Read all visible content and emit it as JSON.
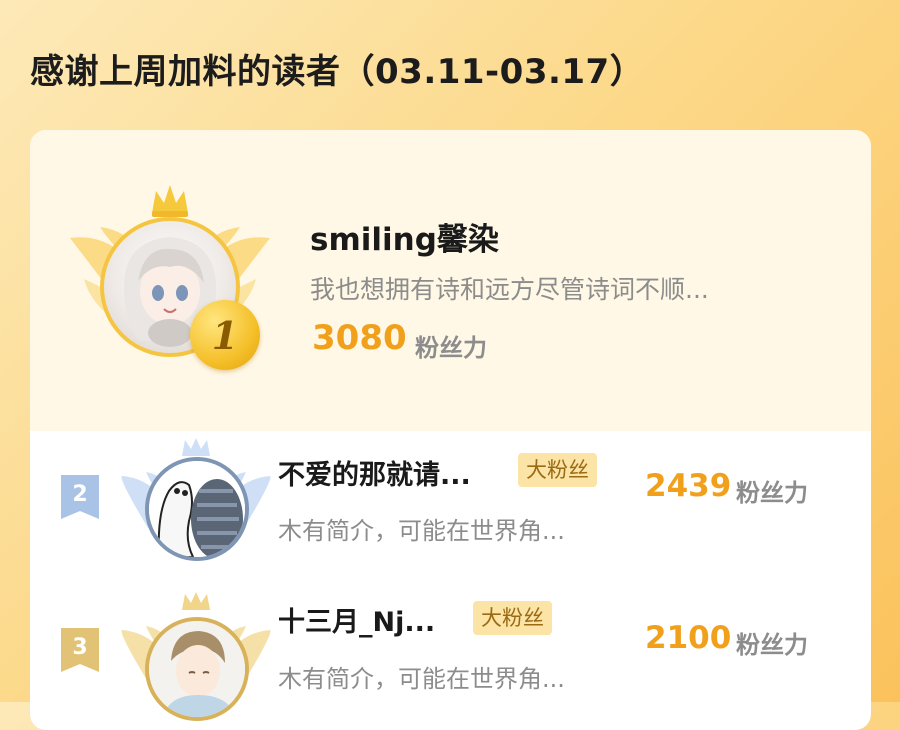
{
  "page": {
    "title": "感谢上周加料的读者（03.11-03.17）"
  },
  "unit_label": "粉丝力",
  "top_reader": {
    "rank": "1",
    "name": "smiling馨染",
    "bio": "我也想拥有诗和远方尽管诗词不顺...",
    "score": "3080",
    "avatar_icon": "anime-girl-avatar",
    "badge_icon": "gold-crown-wings-badge"
  },
  "readers": [
    {
      "rank": "2",
      "name": "不爱的那就请...",
      "badge": "大粉丝",
      "bio": "木有简介，可能在世界角...",
      "score": "2439",
      "avatar_icon": "cartoon-sketch-avatar",
      "badge_icon": "silver-crown-wings-badge"
    },
    {
      "rank": "3",
      "name": "十三月_Nj...",
      "badge": "大粉丝",
      "bio": "木有简介，可能在世界角...",
      "score": "2100",
      "avatar_icon": "anime-boy-avatar",
      "badge_icon": "bronze-crown-wings-badge"
    }
  ],
  "colors": {
    "accent": "#f1a01b",
    "gold": "#f5c542",
    "silver": "#a9c3e6",
    "bronze": "#e2c274",
    "fan_badge_bg": "#fbe4a6"
  }
}
